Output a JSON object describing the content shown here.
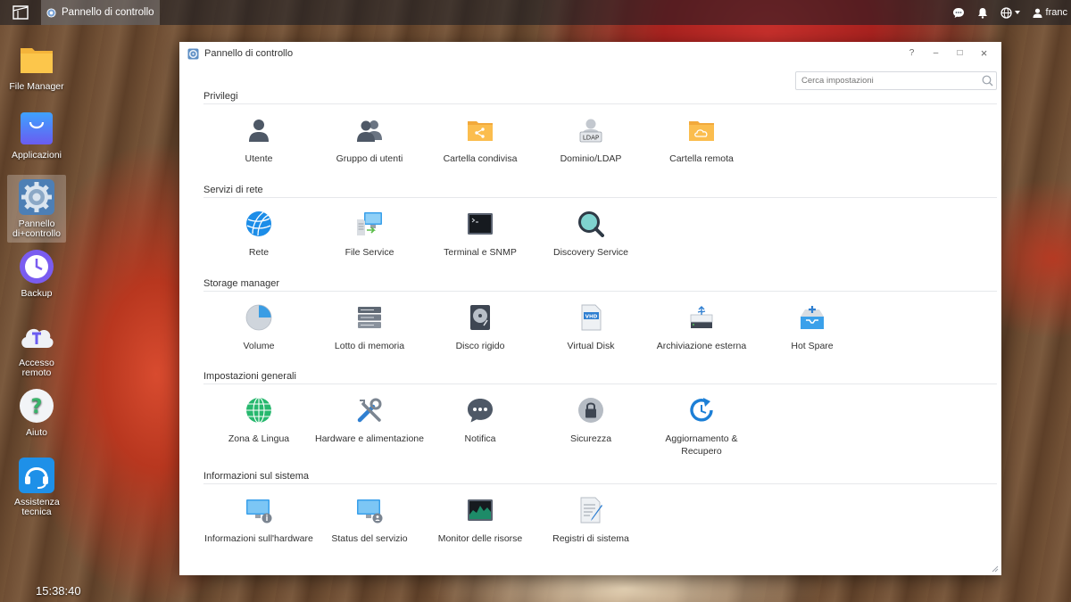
{
  "taskbar": {
    "active_app": "Pannello di controllo",
    "user": "franc"
  },
  "desktop": {
    "icons": [
      {
        "label": "File Manager",
        "icon": "folder-icon"
      },
      {
        "label": "Applicazioni",
        "icon": "shopping-bag-icon"
      },
      {
        "label": "Pannello di+controllo",
        "icon": "gear-icon"
      },
      {
        "label": "Backup",
        "icon": "backup-clock-icon"
      },
      {
        "label": "Accesso remoto",
        "icon": "cloud-icon"
      },
      {
        "label": "Aiuto",
        "icon": "help-icon"
      },
      {
        "label": "Assistenza tecnica",
        "icon": "headset-icon"
      }
    ],
    "clock": "15:38:40"
  },
  "window": {
    "title": "Pannello di controllo",
    "controls": {
      "help": "?",
      "minimize": "–",
      "maximize": "□",
      "close": "×"
    },
    "search_placeholder": "Cerca impostazioni",
    "sections": [
      {
        "title": "Privilegi",
        "items": [
          {
            "label": "Utente",
            "icon": "user-icon"
          },
          {
            "label": "Gruppo di utenti",
            "icon": "user-group-icon"
          },
          {
            "label": "Cartella condivisa",
            "icon": "shared-folder-icon"
          },
          {
            "label": "Dominio/LDAP",
            "icon": "ldap-icon",
            "badge": "LDAP"
          },
          {
            "label": "Cartella remota",
            "icon": "remote-folder-icon"
          }
        ]
      },
      {
        "title": "Servizi di rete",
        "items": [
          {
            "label": "Rete",
            "icon": "network-globe-icon"
          },
          {
            "label": "File Service",
            "icon": "file-service-icon"
          },
          {
            "label": "Terminal e SNMP",
            "icon": "terminal-icon"
          },
          {
            "label": "Discovery Service",
            "icon": "magnifier-icon"
          }
        ]
      },
      {
        "title": "Storage manager",
        "items": [
          {
            "label": "Volume",
            "icon": "volume-pie-icon"
          },
          {
            "label": "Lotto di memoria",
            "icon": "storage-pool-icon"
          },
          {
            "label": "Disco rigido",
            "icon": "hard-disk-icon"
          },
          {
            "label": "Virtual Disk",
            "icon": "virtual-disk-icon",
            "badge": "VHD"
          },
          {
            "label": "Archiviazione esterna",
            "icon": "usb-storage-icon"
          },
          {
            "label": "Hot Spare",
            "icon": "hot-spare-icon"
          }
        ]
      },
      {
        "title": "Impostazioni generali",
        "items": [
          {
            "label": "Zona & Lingua",
            "icon": "globe-icon"
          },
          {
            "label": "Hardware e alimentazione",
            "icon": "tools-icon"
          },
          {
            "label": "Notifica",
            "icon": "chat-bubble-icon"
          },
          {
            "label": "Sicurezza",
            "icon": "lock-icon"
          },
          {
            "label": "Aggiornamento & Recupero",
            "icon": "update-icon"
          }
        ]
      },
      {
        "title": "Informazioni sul sistema",
        "items": [
          {
            "label": "Informazioni sull'hardware",
            "icon": "hardware-info-icon"
          },
          {
            "label": "Status del servizio",
            "icon": "service-status-icon"
          },
          {
            "label": "Monitor delle risorse",
            "icon": "resource-monitor-icon"
          },
          {
            "label": "Registri di sistema",
            "icon": "system-log-icon"
          }
        ]
      }
    ]
  }
}
